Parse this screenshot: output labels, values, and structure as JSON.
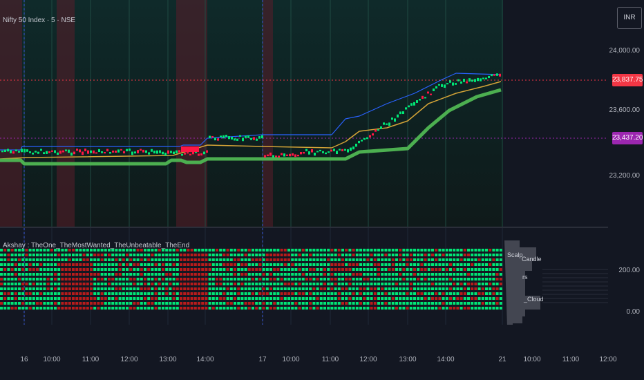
{
  "chart_header": {
    "symbol": "Nifty 50 Index · 5 · NSE"
  },
  "currency": {
    "label": "INR"
  },
  "price_axis": {
    "levels": [
      "24,000.00",
      "23,600.00",
      "23,200.00"
    ],
    "current_price": "23,837.75",
    "marker_price": "23,437.20"
  },
  "indicator": {
    "title": "Akshay : TheOne_TheMostWanted_TheUnbeatable_TheEnd",
    "levels": [
      "200.00",
      "0.00"
    ],
    "legend": [
      "Scalp",
      "Candle",
      "rs",
      "_Cloud"
    ]
  },
  "time_axis": {
    "labels": [
      "16",
      "10:00",
      "11:00",
      "12:00",
      "13:00",
      "14:00",
      "17",
      "10:00",
      "11:00",
      "12:00",
      "13:00",
      "14:00",
      "21",
      "10:00",
      "11:00",
      "12:00"
    ]
  },
  "colors": {
    "bull": "#00e676",
    "bear": "#ff1744",
    "upper_band": "#2962ff",
    "mid_line": "#d4a437",
    "lower_band": "#4caf50",
    "price_tag": "#f23645",
    "marker_tag": "#9c27b0"
  }
}
